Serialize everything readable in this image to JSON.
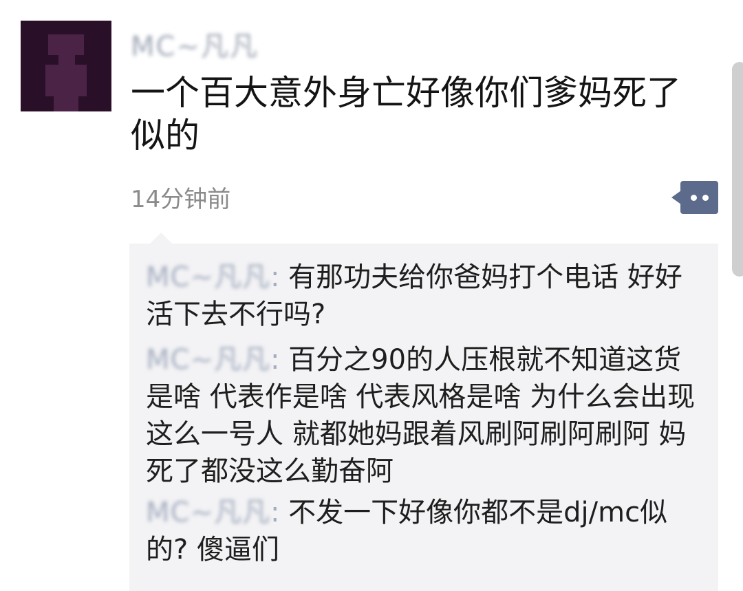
{
  "post": {
    "author_blurred": "MC~凡凡",
    "text": "一个百大意外身亡好像你们爹妈死了似的",
    "timestamp": "14分钟前"
  },
  "comments": [
    {
      "author_blurred": "MC~凡凡",
      "separator": ":",
      "text": "有那功夫给你爸妈打个电话 好好活下去不行吗?"
    },
    {
      "author_blurred": "MC~凡凡",
      "separator": ":",
      "text": "百分之90的人压根就不知道这货是啥 代表作是啥 代表风格是啥 为什么会出现这么一号人 就都她妈跟着风刷阿刷阿刷阿 妈死了都没这么勤奋阿"
    },
    {
      "author_blurred": "MC~凡凡",
      "separator": ":",
      "text": "不发一下好像你都不是dj/mc似的? 傻逼们"
    }
  ],
  "icons": {
    "avatar": "avatar-image",
    "more": "more-dots-icon"
  },
  "colors": {
    "more_button": "#5c6a8c",
    "comment_background": "#f3f3f5",
    "blurred_name": "#a4adbf"
  }
}
